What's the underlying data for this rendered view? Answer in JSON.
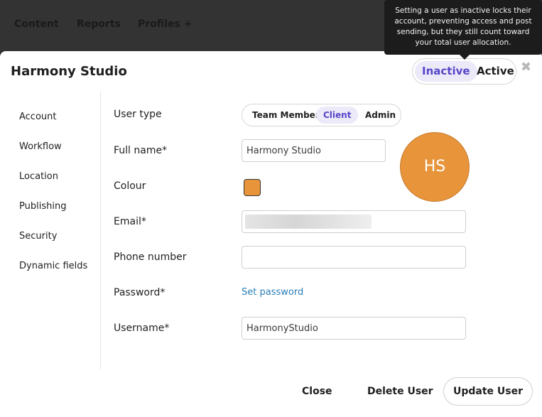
{
  "topnav": {
    "items": [
      {
        "label": "Content"
      },
      {
        "label": "Reports"
      },
      {
        "label": "Profiles +"
      }
    ]
  },
  "tooltip": {
    "text": "Setting a user as inactive locks their account, preventing access and post sending, but they still count toward your total user allocation."
  },
  "modal": {
    "title": "Harmony Studio",
    "status": {
      "inactive_label": "Inactive",
      "active_label": "Active",
      "selected": "Inactive"
    },
    "close_icon": "close-icon"
  },
  "sidebar": {
    "items": [
      {
        "label": "Account"
      },
      {
        "label": "Workflow"
      },
      {
        "label": "Location"
      },
      {
        "label": "Publishing"
      },
      {
        "label": "Security"
      },
      {
        "label": "Dynamic fields"
      }
    ]
  },
  "form": {
    "user_type": {
      "label": "User type",
      "options": [
        "Team Member",
        "Client",
        "Admin"
      ],
      "selected": "Client"
    },
    "full_name": {
      "label": "Full name*",
      "value": "Harmony Studio"
    },
    "colour": {
      "label": "Colour",
      "value": "#e8943a"
    },
    "email": {
      "label": "Email*",
      "value": ""
    },
    "phone": {
      "label": "Phone number",
      "value": ""
    },
    "password": {
      "label": "Password*",
      "link": "Set password"
    },
    "username": {
      "label": "Username*",
      "value": "HarmonyStudio"
    }
  },
  "avatar": {
    "initials": "HS",
    "color": "#e8943a"
  },
  "footer": {
    "close_label": "Close",
    "delete_label": "Delete User",
    "update_label": "Update User"
  },
  "colors": {
    "accent": "#5646c8",
    "accent_bg": "#ece9f8",
    "link": "#2a7fb8"
  }
}
